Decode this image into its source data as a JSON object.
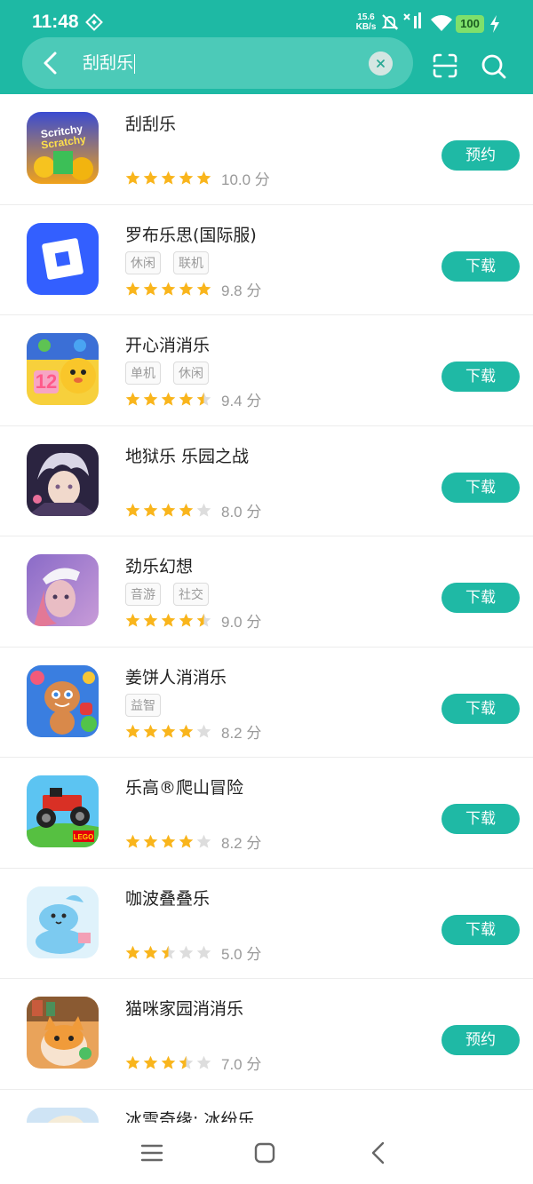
{
  "status_bar": {
    "time": "11:48",
    "net_speed_value": "15.6",
    "net_speed_unit": "KB/s",
    "battery": "100"
  },
  "search": {
    "query": "刮刮乐"
  },
  "apps": [
    {
      "name": "刮刮乐",
      "tags": [],
      "rating": 10.0,
      "score_text": "10.0 分",
      "action": "预约",
      "icon": "scratchy-scratch-icon"
    },
    {
      "name": "罗布乐思(国际服)",
      "tags": [
        "休闲",
        "联机"
      ],
      "rating": 9.8,
      "score_text": "9.8 分",
      "action": "下载",
      "icon": "roblox-icon"
    },
    {
      "name": "开心消消乐",
      "tags": [
        "单机",
        "休闲"
      ],
      "rating": 9.4,
      "score_text": "9.4 分",
      "action": "下载",
      "icon": "happy-elimination-icon"
    },
    {
      "name": "地狱乐 乐园之战",
      "tags": [],
      "rating": 8.0,
      "score_text": "8.0 分",
      "action": "下载",
      "icon": "hells-paradise-icon"
    },
    {
      "name": "劲乐幻想",
      "tags": [
        "音游",
        "社交"
      ],
      "rating": 9.0,
      "score_text": "9.0 分",
      "action": "下载",
      "icon": "jinle-fantasy-icon"
    },
    {
      "name": "姜饼人消消乐",
      "tags": [
        "益智"
      ],
      "rating": 8.2,
      "score_text": "8.2 分",
      "action": "下载",
      "icon": "gingerbread-icon"
    },
    {
      "name": "乐高®爬山冒险",
      "tags": [],
      "rating": 8.2,
      "score_text": "8.2 分",
      "action": "下载",
      "icon": "lego-hill-climb-icon"
    },
    {
      "name": "咖波叠叠乐",
      "tags": [],
      "rating": 5.0,
      "score_text": "5.0 分",
      "action": "下载",
      "icon": "capoo-stack-icon"
    },
    {
      "name": "猫咪家园消消乐",
      "tags": [],
      "rating": 7.0,
      "score_text": "7.0 分",
      "action": "预约",
      "icon": "cat-home-icon"
    },
    {
      "name": "冰雪奇缘: 冰纷乐",
      "tags": [],
      "rating": null,
      "score_text": "",
      "action": "",
      "icon": "frozen-icon"
    }
  ],
  "colors": {
    "accent": "#1eb9a4",
    "star": "#f9b51c",
    "star_empty": "#dddddd"
  }
}
